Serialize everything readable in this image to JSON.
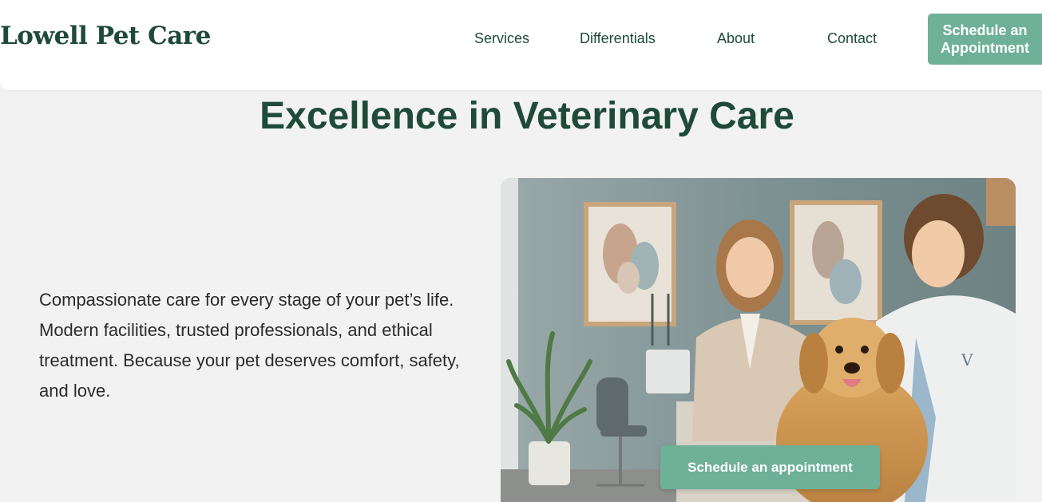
{
  "header": {
    "logo": "Lowell Pet Care",
    "nav": {
      "services": "Services",
      "differentials": "Differentials",
      "about": "About",
      "contact": "Contact"
    },
    "cta_label": "Schedule an Appointment"
  },
  "hero": {
    "title": "Excellence in Veterinary Care",
    "description": "Compassionate care for every stage of your pet’s life. Modern facilities, trusted professionals, and ethical treatment. Because your pet deserves comfort, safety, and love.",
    "image_alt": "Veterinarian and pet owner with a smiling golden retriever in a clinic",
    "cta_label": "Schedule an appointment",
    "coat_monogram": "V"
  },
  "colors": {
    "brand_dark": "#1f4a3a",
    "accent": "#6fb099",
    "page_bg": "#f2f2f2",
    "header_bg": "#ffffff"
  }
}
